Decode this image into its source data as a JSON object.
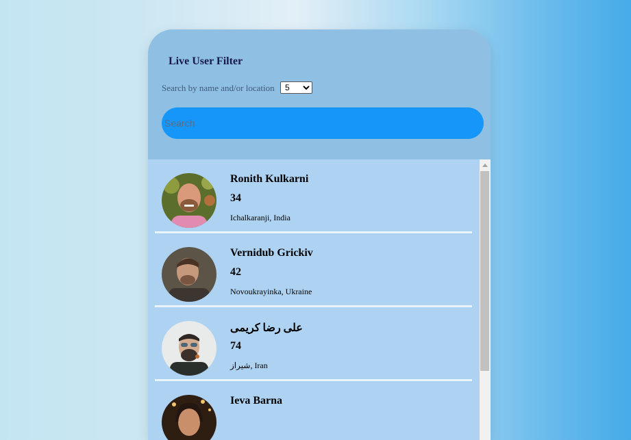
{
  "header": {
    "title": "Live User Filter",
    "subtitle": "Search by name and/or location",
    "count_select": {
      "value": "5",
      "options": [
        "5"
      ]
    },
    "search_placeholder": "Search"
  },
  "users": [
    {
      "name": "Ronith Kulkarni",
      "age": "34",
      "location": "Ichalkaranji, India"
    },
    {
      "name": "Vernidub Grickiv",
      "age": "42",
      "location": "Novoukrayinka, Ukraine"
    },
    {
      "name": "علی رضا کریمی",
      "age": "74",
      "location": "شیراز, Iran"
    },
    {
      "name": "Ieva Barna",
      "age": "",
      "location": ""
    }
  ],
  "colors": {
    "header_bg": "#8fbfe3",
    "list_bg": "#aed3f2",
    "search_bg": "#1796f9",
    "title": "#17194a"
  }
}
